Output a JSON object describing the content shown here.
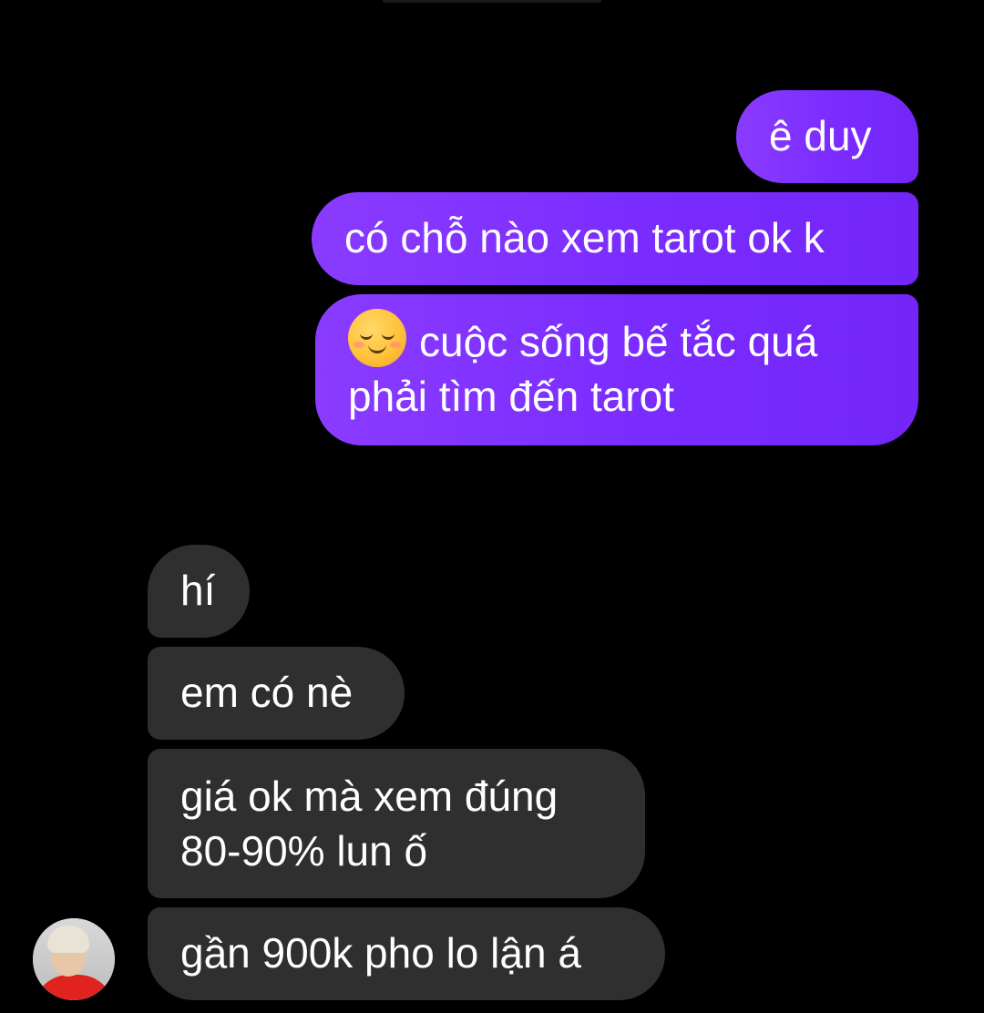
{
  "conversation": {
    "sent_messages": [
      {
        "text": "ê duy"
      },
      {
        "text": "có chỗ nào xem tarot ok k"
      },
      {
        "emoji": "smiling-face-emoji",
        "line1": "cuộc sống bế tắc quá",
        "line2": "phải tìm đến tarot"
      }
    ],
    "received_messages": [
      {
        "text": "hí"
      },
      {
        "text": "em có nè"
      },
      {
        "line1": "giá ok mà xem đúng",
        "line2": "80-90% lun ố"
      },
      {
        "text": "gần 900k pho lo lận á"
      }
    ],
    "colors": {
      "background": "#000000",
      "sent_bubble": "#7d2dff",
      "received_bubble": "#2f2f2f",
      "text": "#ffffff"
    }
  }
}
